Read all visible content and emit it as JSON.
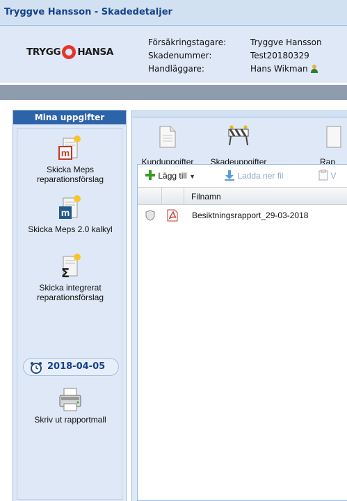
{
  "window": {
    "title": "Tryggve Hansson - Skadedetaljer"
  },
  "header": {
    "logo": {
      "left": "TRYGG",
      "right": "HANSA"
    },
    "labels": {
      "policyholder": "Försäkringstagare:",
      "claim_number": "Skadenummer:",
      "handler": "Handläggare:"
    },
    "values": {
      "policyholder": "Tryggve Hansson",
      "claim_number": "Test20180329",
      "handler": "Hans Wikman"
    }
  },
  "left_panel": {
    "title": "Mina uppgifter",
    "tasks": [
      {
        "label": "Skicka Meps reparationsförslag",
        "icon": "meps-m-icon"
      },
      {
        "label": "Skicka Meps 2.0 kalkyl",
        "icon": "meps-20-icon"
      },
      {
        "label": "Skicka integrerat reparationsförslag",
        "icon": "sum-sigma-icon"
      }
    ],
    "due_date": "2018-04-05",
    "print": {
      "label": "Skriv ut rapportmall",
      "icon": "printer-icon"
    }
  },
  "main_toolbar": {
    "buttons": [
      {
        "label": "Kunduppgifter",
        "icon": "document-icon"
      },
      {
        "label": "Skadeuppgifter",
        "icon": "roadblock-icon"
      },
      {
        "label": "Rap",
        "icon": "report-icon"
      }
    ]
  },
  "file_toolbar": {
    "add": "Lägg till",
    "download": "Ladda ner fil",
    "view": "V"
  },
  "file_grid": {
    "columns": [
      "Filnamn"
    ],
    "rows": [
      {
        "filename": "Besiktningsrapport_29-03-2018"
      }
    ]
  },
  "colors": {
    "accent": "#2d63a9",
    "panel_bg": "#dfe8f6",
    "border": "#99bbe8"
  }
}
